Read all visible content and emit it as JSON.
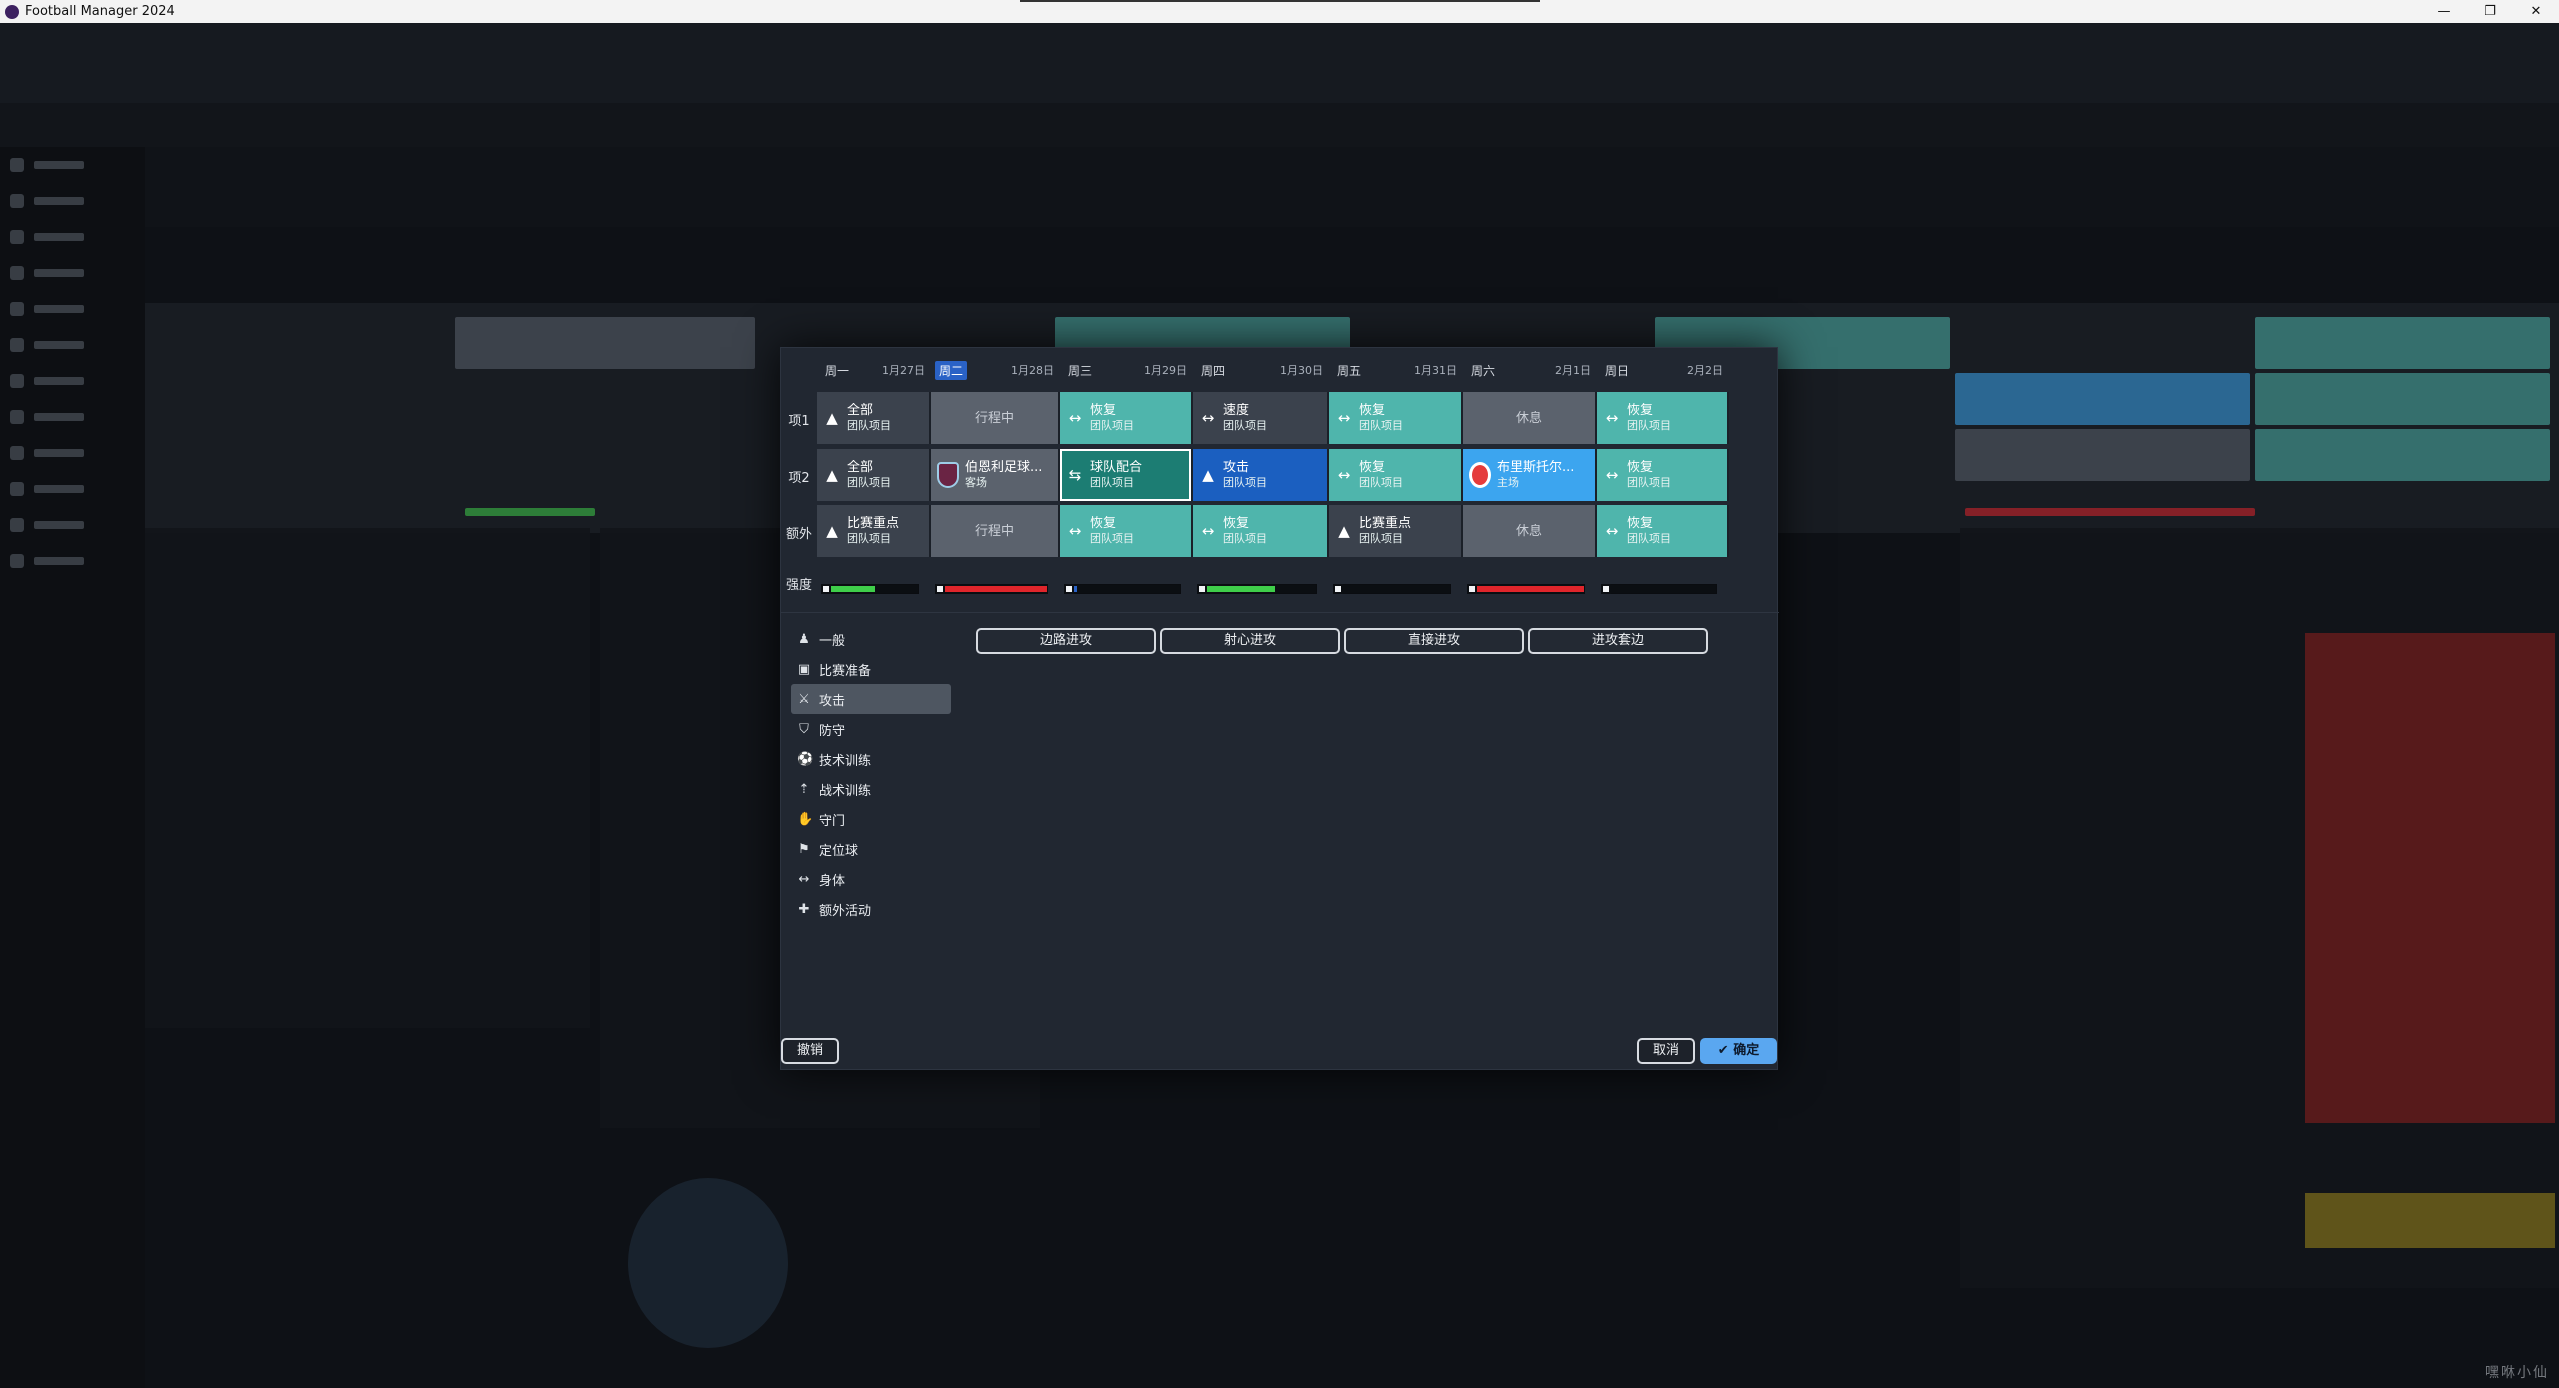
{
  "window": {
    "title": "Football Manager 2024",
    "controls": [
      "—",
      "❐",
      "✕"
    ]
  },
  "calendar": {
    "days": [
      {
        "name": "周一",
        "date": "1月27日",
        "active": false
      },
      {
        "name": "周二",
        "date": "1月28日",
        "active": true
      },
      {
        "name": "周三",
        "date": "1月29日",
        "active": false
      },
      {
        "name": "周四",
        "date": "1月30日",
        "active": false
      },
      {
        "name": "周五",
        "date": "1月31日",
        "active": false
      },
      {
        "name": "周六",
        "date": "2月1日",
        "active": false
      },
      {
        "name": "周日",
        "date": "2月2日",
        "active": false
      }
    ],
    "rows": [
      {
        "label": "项1",
        "cells": [
          {
            "icon": "▲",
            "title": "全部",
            "sub": "团队项目",
            "style": "dark"
          },
          {
            "title": "行程中",
            "style": "gray",
            "center": true
          },
          {
            "icon": "↔",
            "title": "恢复",
            "sub": "团队项目",
            "style": "teal"
          },
          {
            "icon": "↔",
            "title": "速度",
            "sub": "团队项目",
            "style": "dark"
          },
          {
            "icon": "↔",
            "title": "恢复",
            "sub": "团队项目",
            "style": "teal"
          },
          {
            "title": "休息",
            "style": "gray",
            "center": true
          },
          {
            "icon": "↔",
            "title": "恢复",
            "sub": "团队项目",
            "style": "teal"
          }
        ]
      },
      {
        "label": "项2",
        "cells": [
          {
            "icon": "▲",
            "title": "全部",
            "sub": "团队项目",
            "style": "dark"
          },
          {
            "crest": "burnley",
            "title": "伯恩利足球...",
            "sub": "客场",
            "style": "gray"
          },
          {
            "icon": "⇆",
            "title": "球队配合",
            "sub": "团队项目",
            "style": "sel"
          },
          {
            "icon": "▲",
            "title": "攻击",
            "sub": "团队项目",
            "style": "blue"
          },
          {
            "icon": "↔",
            "title": "恢复",
            "sub": "团队项目",
            "style": "teal"
          },
          {
            "crest": "brent",
            "title": "布里斯托尔...",
            "sub": "主场",
            "style": "lblue"
          },
          {
            "icon": "↔",
            "title": "恢复",
            "sub": "团队项目",
            "style": "teal"
          }
        ]
      },
      {
        "label": "额外",
        "cells": [
          {
            "icon": "▲",
            "title": "比赛重点",
            "sub": "团队项目",
            "style": "dark"
          },
          {
            "title": "行程中",
            "style": "gray",
            "center": true
          },
          {
            "icon": "↔",
            "title": "恢复",
            "sub": "团队项目",
            "style": "teal"
          },
          {
            "icon": "↔",
            "title": "恢复",
            "sub": "团队项目",
            "style": "teal"
          },
          {
            "icon": "▲",
            "title": "比赛重点",
            "sub": "团队项目",
            "style": "dark"
          },
          {
            "title": "休息",
            "style": "gray",
            "center": true
          },
          {
            "icon": "↔",
            "title": "恢复",
            "sub": "团队项目",
            "style": "teal"
          }
        ]
      }
    ],
    "intensity_label": "强度",
    "intensity": [
      {
        "level": 0.55,
        "color": "#3fce4a"
      },
      {
        "level": 1.0,
        "color": "#e0252b"
      },
      {
        "level": 0.1,
        "color": "#2a62c6"
      },
      {
        "level": 0.65,
        "color": "#3fce4a"
      },
      {
        "level": 0.0,
        "color": "#3fce4a"
      },
      {
        "level": 1.0,
        "color": "#e0252b"
      },
      {
        "level": 0.0,
        "color": "#3fce4a"
      }
    ]
  },
  "categories": [
    {
      "icon": "♟",
      "label": "一般",
      "active": false
    },
    {
      "icon": "▣",
      "label": "比赛准备",
      "active": false
    },
    {
      "icon": "⚔",
      "label": "攻击",
      "active": true
    },
    {
      "icon": "⛉",
      "label": "防守",
      "active": false
    },
    {
      "icon": "⚽",
      "label": "技术训练",
      "active": false
    },
    {
      "icon": "⇡",
      "label": "战术训练",
      "active": false
    },
    {
      "icon": "✋",
      "label": "守门",
      "active": false
    },
    {
      "icon": "⚑",
      "label": "定位球",
      "active": false
    },
    {
      "icon": "↔",
      "label": "身体",
      "active": false
    },
    {
      "icon": "✚",
      "label": "额外活动",
      "active": false
    }
  ],
  "options": [
    "边路进攻",
    "射心进攻",
    "直接进攻",
    "进攻套边"
  ],
  "buttons": {
    "undo": "撤销",
    "cancel": "取消",
    "ok": "确定",
    "ok_icon": "✔"
  },
  "watermark": "嘿咻小仙"
}
